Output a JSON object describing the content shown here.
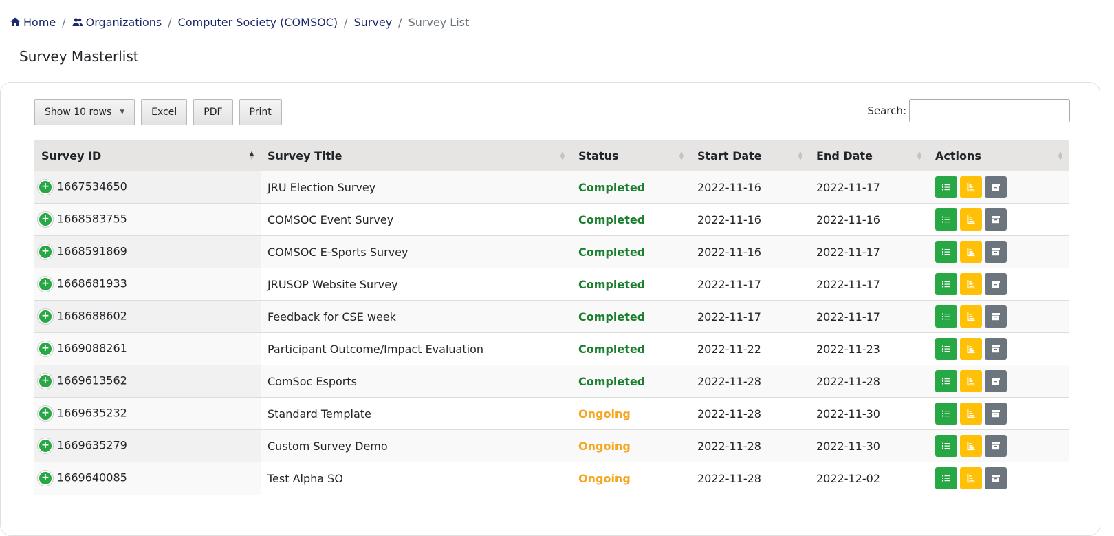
{
  "breadcrumb": {
    "home": "Home",
    "organizations": "Organizations",
    "org": "Computer Society (COMSOC)",
    "survey": "Survey",
    "current": "Survey List"
  },
  "page_title": "Survey Masterlist",
  "toolbar": {
    "rows_label": "Show 10 rows",
    "excel_label": "Excel",
    "pdf_label": "PDF",
    "print_label": "Print"
  },
  "search": {
    "label": "Search:",
    "value": ""
  },
  "table": {
    "headers": [
      "Survey ID",
      "Survey Title",
      "Status",
      "Start Date",
      "End Date",
      "Actions"
    ],
    "rows": [
      {
        "id": "1667534650",
        "title": "JRU Election Survey",
        "status": "Completed",
        "start": "2022-11-16",
        "end": "2022-11-17"
      },
      {
        "id": "1668583755",
        "title": "COMSOC Event Survey",
        "status": "Completed",
        "start": "2022-11-16",
        "end": "2022-11-16"
      },
      {
        "id": "1668591869",
        "title": "COMSOC E-Sports Survey",
        "status": "Completed",
        "start": "2022-11-16",
        "end": "2022-11-17"
      },
      {
        "id": "1668681933",
        "title": "JRUSOP Website Survey",
        "status": "Completed",
        "start": "2022-11-17",
        "end": "2022-11-17"
      },
      {
        "id": "1668688602",
        "title": "Feedback for CSE week",
        "status": "Completed",
        "start": "2022-11-17",
        "end": "2022-11-17"
      },
      {
        "id": "1669088261",
        "title": "Participant Outcome/Impact Evaluation",
        "status": "Completed",
        "start": "2022-11-22",
        "end": "2022-11-23"
      },
      {
        "id": "1669613562",
        "title": "ComSoc Esports",
        "status": "Completed",
        "start": "2022-11-28",
        "end": "2022-11-28"
      },
      {
        "id": "1669635232",
        "title": "Standard Template",
        "status": "Ongoing",
        "start": "2022-11-28",
        "end": "2022-11-30"
      },
      {
        "id": "1669635279",
        "title": "Custom Survey Demo",
        "status": "Ongoing",
        "start": "2022-11-28",
        "end": "2022-11-30"
      },
      {
        "id": "1669640085",
        "title": "Test Alpha SO",
        "status": "Ongoing",
        "start": "2022-11-28",
        "end": "2022-12-02"
      }
    ]
  },
  "colors": {
    "completed": "#1a7f2e",
    "ongoing": "#f5a623",
    "view_button": "#28a745",
    "report_button": "#ffc107",
    "archive_button": "#6c757d",
    "breadcrumb_link": "#1b2a6b"
  },
  "icons": {
    "home": "home-icon",
    "organizations": "users-icon",
    "expand": "plus-circle-icon",
    "view": "list-icon",
    "report": "chart-bars-icon",
    "archive": "archive-icon"
  }
}
